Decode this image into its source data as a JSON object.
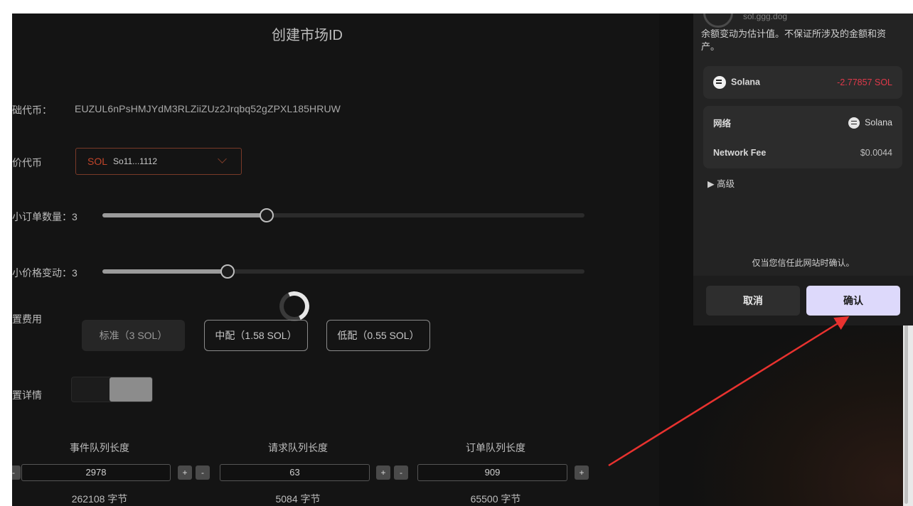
{
  "app": {
    "title": "创建市场ID",
    "base_mint_label": "础代币：",
    "base_mint_value": "EUZUL6nPsHMJYdM3RLZiiZUz2Jrqbq52gZPXL185HRUW",
    "quote_label": "价代币",
    "quote_symbol": "SOL",
    "quote_address": "So11...1112",
    "min_order_label": "小订单数量：3",
    "min_order_value": 3,
    "min_order_fraction": 0.34,
    "tick_label": "小价格变动：3",
    "tick_value": 3,
    "tick_fraction": 0.26,
    "fee_label": "置费用",
    "fee_options": [
      "标准（3 SOL）",
      "中配（1.58 SOL）",
      "低配（0.55 SOL）"
    ],
    "detail_label": "置详情",
    "queues": [
      {
        "header": "事件队列长度",
        "value": "2978",
        "bytes": "262108 字节"
      },
      {
        "header": "请求队列长度",
        "value": "63",
        "bytes": "5084 字节"
      },
      {
        "header": "订单队列长度",
        "value": "909",
        "bytes": "65500 字节"
      }
    ],
    "plus": "+",
    "minus": "-"
  },
  "wallet": {
    "site": "sol.ggg.dog",
    "note": "余额变动为估计值。不保证所涉及的金额和资产。",
    "asset_name": "Solana",
    "asset_change": "-2.77857 SOL",
    "network_label": "网络",
    "network_value": "Solana",
    "fee_label": "Network Fee",
    "fee_value": "$0.0044",
    "advanced": "▶ 高级",
    "trust": "仅当您信任此网站时确认。",
    "cancel": "取消",
    "confirm": "确认",
    "colors": {
      "negative": "#e0394a",
      "confirm_bg": "#ddd9fb",
      "arrow": "#e8322f"
    }
  }
}
